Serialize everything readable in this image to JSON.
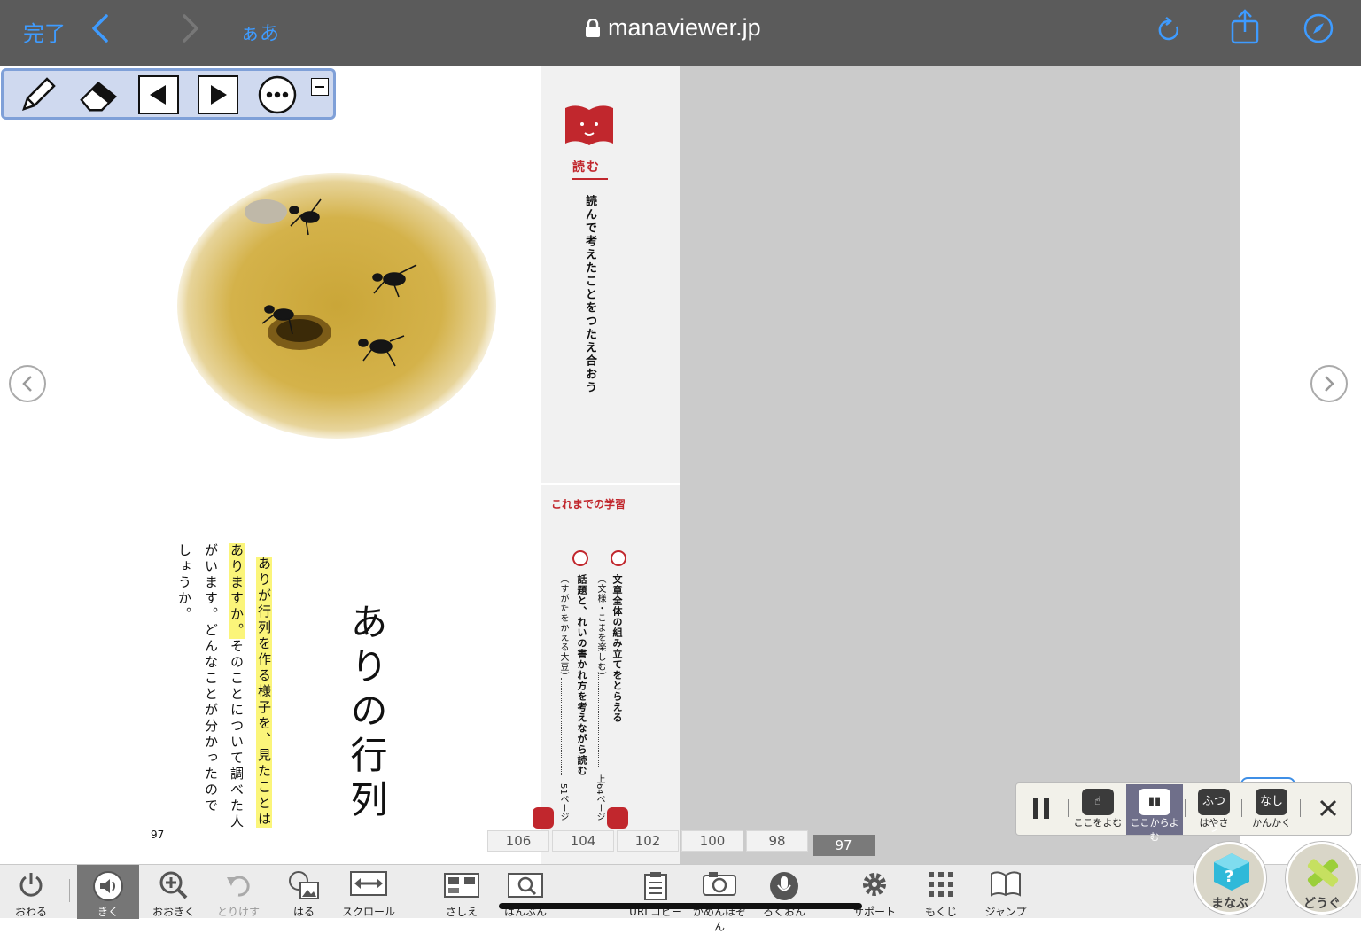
{
  "browser": {
    "done_label": "完了",
    "text_size_label": "ぁあ",
    "url": "manaviewer.jp"
  },
  "palette": {
    "tools": [
      "pencil-icon",
      "eraser-icon",
      "prev-page-icon",
      "next-page-icon",
      "more-icon",
      "minimize-icon"
    ]
  },
  "left_page": {
    "title": "ありの行列",
    "body_columns": [
      "ありが行列を作る様子を、見たことは",
      "ありますか。",
      "そのことについて調べた人",
      "がいます。どんなことが分かったので",
      "しょうか。"
    ],
    "page_number": "97"
  },
  "side_strip": {
    "read_label": "読む",
    "objective": "読んで考えたことをつたえ合おう",
    "previous_heading": "これまでの学習",
    "items": [
      {
        "line1": "文章全体の組み立てをとらえる",
        "line2": "（文様・こまを楽しむ）",
        "page_ref": "上64ページ"
      },
      {
        "line1": "話題と、れいの書かれ方を考えながら読む",
        "line2": "（すがたをかえる大豆）",
        "page_ref": "51ページ"
      }
    ]
  },
  "page_tabs": [
    "106",
    "104",
    "102",
    "100",
    "98",
    "97"
  ],
  "active_page_tab": "97",
  "reading_panel": {
    "buttons": [
      {
        "icon": "pause-icon",
        "label": ""
      },
      {
        "icon": "read-here-icon",
        "label": "ここをよむ"
      },
      {
        "icon": "read-from-here-icon",
        "label": "ここからよむ"
      },
      {
        "icon": "speed-icon",
        "label": "はやさ",
        "value": "ふつう"
      },
      {
        "icon": "interval-icon",
        "label": "かんかく",
        "value": "なし"
      },
      {
        "icon": "close-icon",
        "label": ""
      }
    ]
  },
  "bottom_toolbar": {
    "items": [
      {
        "label": "おわる",
        "icon": "power-icon"
      },
      {
        "label": "きく",
        "icon": "speaker-icon"
      },
      {
        "label": "おおきく",
        "icon": "zoom-in-icon"
      },
      {
        "label": "とりけす",
        "icon": "undo-icon"
      },
      {
        "label": "はる",
        "icon": "paste-image-icon"
      },
      {
        "label": "スクロール",
        "icon": "scroll-icon"
      },
      {
        "label": "さしえ",
        "icon": "illustration-icon"
      },
      {
        "label": "はんぶん",
        "icon": "half-view-icon"
      },
      {
        "label": "URLコピー",
        "icon": "clipboard-icon"
      },
      {
        "label": "がめんほぞん",
        "icon": "camera-icon"
      },
      {
        "label": "ろくおん",
        "icon": "microphone-icon"
      },
      {
        "label": "サポート",
        "icon": "gear-icon"
      },
      {
        "label": "もくじ",
        "icon": "grid-icon"
      },
      {
        "label": "ジャンプ",
        "icon": "book-icon"
      }
    ],
    "manabu_label": "まなぶ",
    "dougu_label": "どうぐ"
  },
  "colors": {
    "accent_blue": "#3e9bff",
    "textbook_red": "#c1272d",
    "highlight_yellow": "#fbf57a"
  }
}
